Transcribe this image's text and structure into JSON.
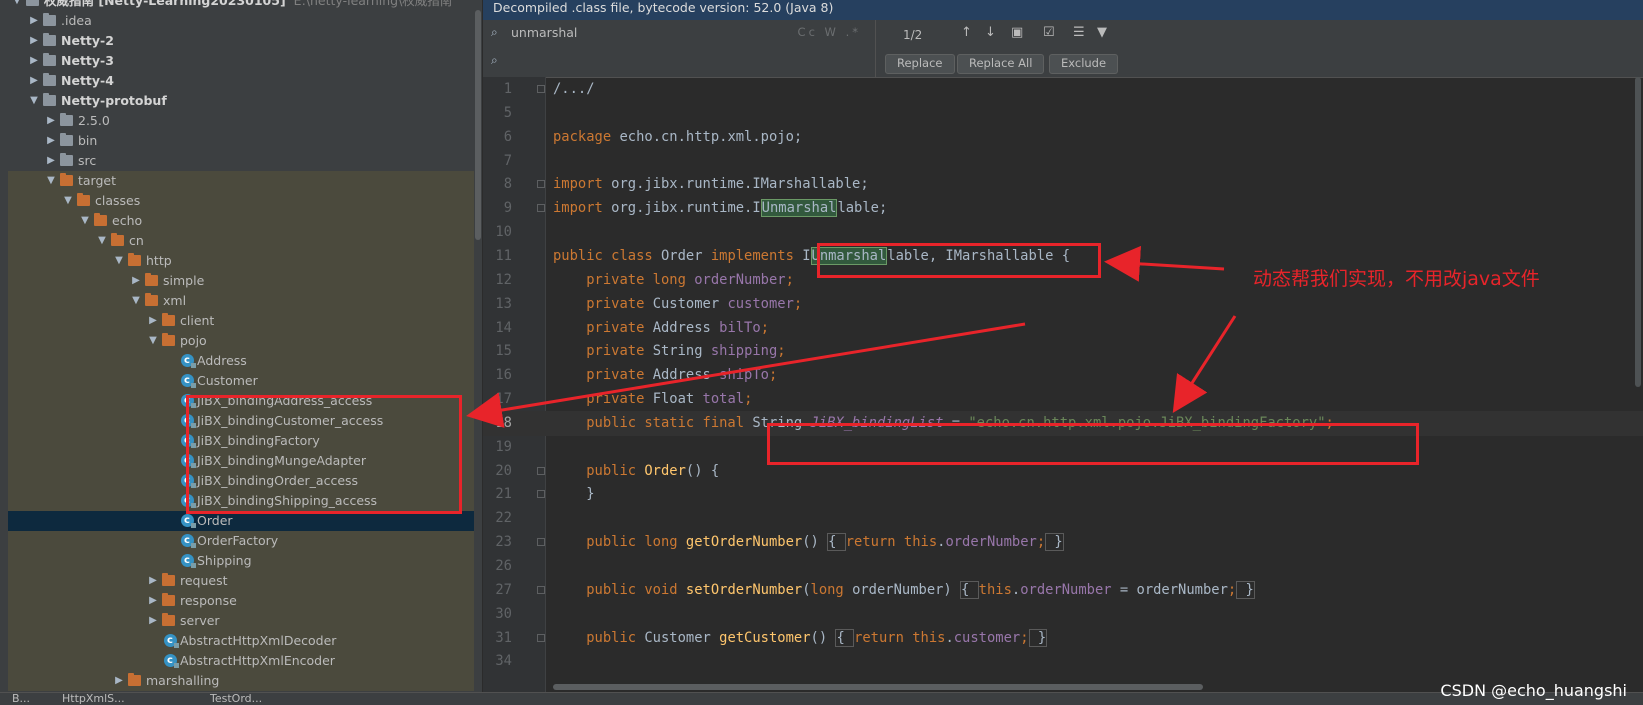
{
  "project_tree": [
    {
      "depth": 0,
      "arrow": "open",
      "icon": "folder",
      "label": "权威指南",
      "bold": true,
      "extra_bold": "[Netty-Learning20230105]",
      "path": "E:\\netty-learning\\权威指南",
      "state": ""
    },
    {
      "depth": 1,
      "arrow": "closed",
      "icon": "folder",
      "label": ".idea",
      "bold": false,
      "state": ""
    },
    {
      "depth": 1,
      "arrow": "closed",
      "icon": "folder",
      "label": "Netty-2",
      "bold": true,
      "state": ""
    },
    {
      "depth": 1,
      "arrow": "closed",
      "icon": "folder",
      "label": "Netty-3",
      "bold": true,
      "state": ""
    },
    {
      "depth": 1,
      "arrow": "closed",
      "icon": "folder",
      "label": "Netty-4",
      "bold": true,
      "state": ""
    },
    {
      "depth": 1,
      "arrow": "open",
      "icon": "folder",
      "label": "Netty-protobuf",
      "bold": true,
      "state": ""
    },
    {
      "depth": 2,
      "arrow": "closed",
      "icon": "folder",
      "label": "2.5.0",
      "bold": false,
      "state": ""
    },
    {
      "depth": 2,
      "arrow": "closed",
      "icon": "folder",
      "label": "bin",
      "bold": false,
      "state": ""
    },
    {
      "depth": 2,
      "arrow": "closed",
      "icon": "folder",
      "label": "src",
      "bold": false,
      "state": ""
    },
    {
      "depth": 2,
      "arrow": "open",
      "icon": "folder-orange",
      "label": "target",
      "bold": false,
      "state": "hl"
    },
    {
      "depth": 3,
      "arrow": "open",
      "icon": "folder-orange",
      "label": "classes",
      "bold": false,
      "state": "hl"
    },
    {
      "depth": 4,
      "arrow": "open",
      "icon": "folder-orange",
      "label": "echo",
      "bold": false,
      "state": "hl"
    },
    {
      "depth": 5,
      "arrow": "open",
      "icon": "folder-orange",
      "label": "cn",
      "bold": false,
      "state": "hl"
    },
    {
      "depth": 6,
      "arrow": "open",
      "icon": "folder-orange",
      "label": "http",
      "bold": false,
      "state": "hl"
    },
    {
      "depth": 7,
      "arrow": "closed",
      "icon": "folder-orange",
      "label": "simple",
      "bold": false,
      "state": "hl"
    },
    {
      "depth": 7,
      "arrow": "open",
      "icon": "folder-orange",
      "label": "xml",
      "bold": false,
      "state": "hl"
    },
    {
      "depth": 8,
      "arrow": "closed",
      "icon": "folder-orange",
      "label": "client",
      "bold": false,
      "state": "hl"
    },
    {
      "depth": 8,
      "arrow": "open",
      "icon": "folder-orange",
      "label": "pojo",
      "bold": false,
      "state": "hl"
    },
    {
      "depth": 9,
      "arrow": "",
      "icon": "class",
      "label": "Address",
      "bold": false,
      "state": "hl"
    },
    {
      "depth": 9,
      "arrow": "",
      "icon": "class",
      "label": "Customer",
      "bold": false,
      "state": "hl"
    },
    {
      "depth": 9,
      "arrow": "",
      "icon": "class",
      "label": "JiBX_bindingAddress_access",
      "bold": false,
      "state": "hl"
    },
    {
      "depth": 9,
      "arrow": "",
      "icon": "class",
      "label": "JiBX_bindingCustomer_access",
      "bold": false,
      "state": "hl"
    },
    {
      "depth": 9,
      "arrow": "",
      "icon": "class",
      "label": "JiBX_bindingFactory",
      "bold": false,
      "state": "hl"
    },
    {
      "depth": 9,
      "arrow": "",
      "icon": "class",
      "label": "JiBX_bindingMungeAdapter",
      "bold": false,
      "state": "hl"
    },
    {
      "depth": 9,
      "arrow": "",
      "icon": "class",
      "label": "JiBX_bindingOrder_access",
      "bold": false,
      "state": "hl"
    },
    {
      "depth": 9,
      "arrow": "",
      "icon": "class",
      "label": "JiBX_bindingShipping_access",
      "bold": false,
      "state": "hl"
    },
    {
      "depth": 9,
      "arrow": "",
      "icon": "class",
      "label": "Order",
      "bold": false,
      "state": "sel"
    },
    {
      "depth": 9,
      "arrow": "",
      "icon": "class",
      "label": "OrderFactory",
      "bold": false,
      "state": "hl"
    },
    {
      "depth": 9,
      "arrow": "",
      "icon": "class",
      "label": "Shipping",
      "bold": false,
      "state": "hl"
    },
    {
      "depth": 8,
      "arrow": "closed",
      "icon": "folder-orange",
      "label": "request",
      "bold": false,
      "state": "hl"
    },
    {
      "depth": 8,
      "arrow": "closed",
      "icon": "folder-orange",
      "label": "response",
      "bold": false,
      "state": "hl"
    },
    {
      "depth": 8,
      "arrow": "closed",
      "icon": "folder-orange",
      "label": "server",
      "bold": false,
      "state": "hl"
    },
    {
      "depth": 8,
      "arrow": "",
      "icon": "class",
      "label": "AbstractHttpXmlDecoder",
      "bold": false,
      "state": "hl"
    },
    {
      "depth": 8,
      "arrow": "",
      "icon": "class",
      "label": "AbstractHttpXmlEncoder",
      "bold": false,
      "state": "hl"
    },
    {
      "depth": 6,
      "arrow": "closed",
      "icon": "folder-orange",
      "label": "marshalling",
      "bold": false,
      "state": "hl"
    }
  ],
  "bottom_tabs": {
    "tab1": "B...",
    "tab2": "HttpXmlS...",
    "tab3": "TestOrd..."
  },
  "editor": {
    "decompile_notice": "Decompiled .class file, bytecode version: 52.0 (Java 8)",
    "search_text": "unmarshal",
    "search_options": "Cc W .*",
    "match_count": "1/2",
    "replace_label": "Replace",
    "replace_all_label": "Replace All",
    "exclude_label": "Exclude",
    "icon_names": [
      "search-icon",
      "clear-icon",
      "history-icon",
      "up-arrow-icon",
      "down-arrow-icon",
      "select-all-icon",
      "filter-icon"
    ]
  },
  "code_lines": [
    {
      "n": "1",
      "fold": true,
      "segs": [
        [
          "/.../",
          ""
        ]
      ]
    },
    {
      "n": "5",
      "segs": []
    },
    {
      "n": "6",
      "segs": [
        [
          "package",
          "kw"
        ],
        [
          " echo.cn.http.xml.pojo;",
          ""
        ]
      ]
    },
    {
      "n": "7",
      "segs": []
    },
    {
      "n": "8",
      "fold": true,
      "segs": [
        [
          "import",
          "kw"
        ],
        [
          " org.jibx.runtime.IMarshallable;",
          ""
        ]
      ]
    },
    {
      "n": "9",
      "fold": true,
      "segs": [
        [
          "import",
          "kw"
        ],
        [
          " org.jibx.runtime.I",
          ""
        ],
        [
          "Unmarshal",
          "mh"
        ],
        [
          "lable;",
          ""
        ]
      ]
    },
    {
      "n": "10",
      "segs": []
    },
    {
      "n": "11",
      "segs": [
        [
          "public class ",
          "kw"
        ],
        [
          "Order ",
          ""
        ],
        [
          "implements ",
          "kw"
        ],
        [
          "I",
          ""
        ],
        [
          "Unmarshal",
          "mh"
        ],
        [
          "lable, IMarshallable {",
          ""
        ]
      ]
    },
    {
      "n": "12",
      "segs": [
        [
          "    private long ",
          "kw"
        ],
        [
          "orderNumber",
          "fld"
        ],
        [
          ";",
          "kw"
        ]
      ]
    },
    {
      "n": "13",
      "segs": [
        [
          "    private ",
          "kw"
        ],
        [
          "Customer ",
          ""
        ],
        [
          "customer",
          "fld"
        ],
        [
          ";",
          "kw"
        ]
      ]
    },
    {
      "n": "14",
      "segs": [
        [
          "    private ",
          "kw"
        ],
        [
          "Address ",
          ""
        ],
        [
          "bilTo",
          "fld"
        ],
        [
          ";",
          "kw"
        ]
      ]
    },
    {
      "n": "15",
      "segs": [
        [
          "    private ",
          "kw"
        ],
        [
          "String ",
          ""
        ],
        [
          "shipping",
          "fld"
        ],
        [
          ";",
          "kw"
        ]
      ]
    },
    {
      "n": "16",
      "segs": [
        [
          "    private ",
          "kw"
        ],
        [
          "Address ",
          ""
        ],
        [
          "shipTo",
          "fld"
        ],
        [
          ";",
          "kw"
        ]
      ]
    },
    {
      "n": "17",
      "segs": [
        [
          "    private ",
          "kw"
        ],
        [
          "Float ",
          ""
        ],
        [
          "total",
          "fld"
        ],
        [
          ";",
          "kw"
        ]
      ]
    },
    {
      "n": "18",
      "cur": true,
      "segs": [
        [
          "    public static final ",
          "kw"
        ],
        [
          "String ",
          ""
        ],
        [
          "JiBX_bindingList",
          "ital"
        ],
        [
          " = ",
          ""
        ],
        [
          "\"echo.cn.http.xml.pojo.JiBX_bindingFactory\"",
          "str"
        ],
        [
          ";",
          "kw"
        ]
      ]
    },
    {
      "n": "19",
      "segs": []
    },
    {
      "n": "20",
      "fold": true,
      "segs": [
        [
          "    public ",
          "kw"
        ],
        [
          "Order",
          "fn"
        ],
        [
          "() {",
          ""
        ]
      ]
    },
    {
      "n": "21",
      "fold": true,
      "segs": [
        [
          "    }",
          ""
        ]
      ]
    },
    {
      "n": "22",
      "segs": []
    },
    {
      "n": "23",
      "fold": true,
      "segs": [
        [
          "    public long ",
          "kw"
        ],
        [
          "getOrderNumber",
          "fn"
        ],
        [
          "() ",
          ""
        ],
        [
          "{ ",
          "fldbox"
        ],
        [
          "return this",
          "kw"
        ],
        [
          ".",
          ""
        ],
        [
          "orderNumber",
          "fld"
        ],
        [
          ";",
          "kw"
        ],
        [
          " }",
          "fldbox"
        ]
      ]
    },
    {
      "n": "26",
      "segs": []
    },
    {
      "n": "27",
      "fold": true,
      "segs": [
        [
          "    public void ",
          "kw"
        ],
        [
          "setOrderNumber",
          "fn"
        ],
        [
          "(",
          ""
        ],
        [
          "long ",
          "kw"
        ],
        [
          "orderNumber) ",
          ""
        ],
        [
          "{ ",
          "fldbox"
        ],
        [
          "this",
          "kw"
        ],
        [
          ".",
          ""
        ],
        [
          "orderNumber",
          "fld"
        ],
        [
          " = orderNumber",
          ""
        ],
        [
          ";",
          "kw"
        ],
        [
          " }",
          "fldbox"
        ]
      ]
    },
    {
      "n": "30",
      "segs": []
    },
    {
      "n": "31",
      "fold": true,
      "segs": [
        [
          "    public ",
          "kw"
        ],
        [
          "Customer ",
          ""
        ],
        [
          "getCustomer",
          "fn"
        ],
        [
          "() ",
          ""
        ],
        [
          "{ ",
          "fldbox"
        ],
        [
          "return this",
          "kw"
        ],
        [
          ".",
          ""
        ],
        [
          "customer",
          "fld"
        ],
        [
          ";",
          "kw"
        ],
        [
          " }",
          "fldbox"
        ]
      ]
    },
    {
      "n": "34",
      "segs": []
    }
  ],
  "annotation": {
    "note": "动态帮我们实现，不用改java文件",
    "color": "#e8242a"
  },
  "watermark": "CSDN @echo_huangshi"
}
